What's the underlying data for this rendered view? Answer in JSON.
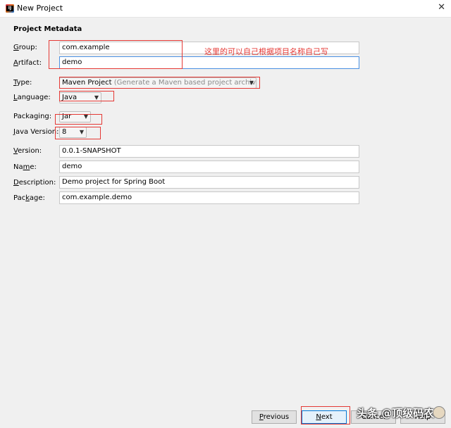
{
  "window": {
    "title": "New Project",
    "close_glyph": "✕",
    "icon": "intellij-idea-icon"
  },
  "section_title": "Project Metadata",
  "labels": {
    "group_mn": "G",
    "group_rest": "roup:",
    "artifact_mn": "A",
    "artifact_rest": "rtifact:",
    "type_mn": "T",
    "type_rest": "ype:",
    "language_mn": "L",
    "language_rest": "anguage:",
    "packaging": "Packaging:",
    "javaversion_mn": "J",
    "javaversion_rest": "ava Version:",
    "version_mn": "V",
    "version_rest": "ersion:",
    "name_pre": "Na",
    "name_mn": "m",
    "name_post": "e:",
    "description_mn": "D",
    "description_rest": "escription:",
    "package_pre": "Pac",
    "package_mn": "k",
    "package_post": "age:"
  },
  "fields": {
    "group": "com.example",
    "artifact": "demo",
    "type_value": "Maven Project",
    "type_hint": "(Generate a Maven based project archive.)",
    "language": "Java",
    "packaging": "Jar",
    "java_version": "8",
    "version": "0.0.1-SNAPSHOT",
    "name": "demo",
    "description": "Demo project for Spring Boot",
    "package": "com.example.demo"
  },
  "annotation": "这里的可以自己根据项目名称自己写",
  "buttons": {
    "previous_mn": "P",
    "previous_rest": "revious",
    "next_mn": "N",
    "next_rest": "ext",
    "cancel": "Cancel",
    "help": "Help"
  },
  "watermark": "头条 @顶级码农",
  "colors": {
    "annotation_red": "#e53935",
    "focus_blue": "#4a90e2",
    "background": "#f0f0f0"
  }
}
